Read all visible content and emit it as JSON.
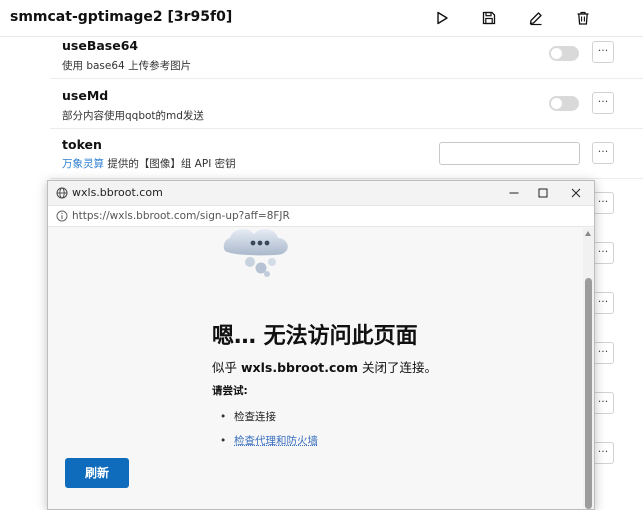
{
  "app": {
    "title": "smmcat-gptimage2 [3r95f0]",
    "toolbar": {
      "run": "play-icon",
      "save": "save-icon",
      "edit": "edit-icon",
      "delete": "trash-icon"
    }
  },
  "config_rows": [
    {
      "key": "useBase64",
      "desc": "使用 base64 上传参考图片",
      "control": "toggle",
      "enabled": false,
      "more": "···"
    },
    {
      "key": "useMd",
      "desc": "部分内容使用qqbot的md发送",
      "control": "toggle",
      "enabled": false,
      "more": "···"
    },
    {
      "key": "token",
      "desc_link": "万象灵算",
      "desc_rest": " 提供的【图像】组 API 密钥",
      "control": "input",
      "value": "",
      "more": "···"
    }
  ],
  "background_more_buttons": [
    "···",
    "···",
    "···",
    "···",
    "···",
    "···"
  ],
  "popup": {
    "window_title": "wxls.bbroot.com",
    "url": "https://wxls.bbroot.com/sign-up?aff=8FJR",
    "error": {
      "title": "嗯… 无法访问此页面",
      "sub_pre": "似乎 ",
      "sub_host": "wxls.bbroot.com",
      "sub_post": " 关闭了连接。",
      "try_label": "请尝试:",
      "suggestions": [
        "检查连接",
        "检查代理和防火墙"
      ],
      "reload_label": "刷新"
    }
  },
  "colors": {
    "accent": "#0f6cbd",
    "link": "#2f80d1",
    "toggle_off": "#d9d9d9"
  }
}
